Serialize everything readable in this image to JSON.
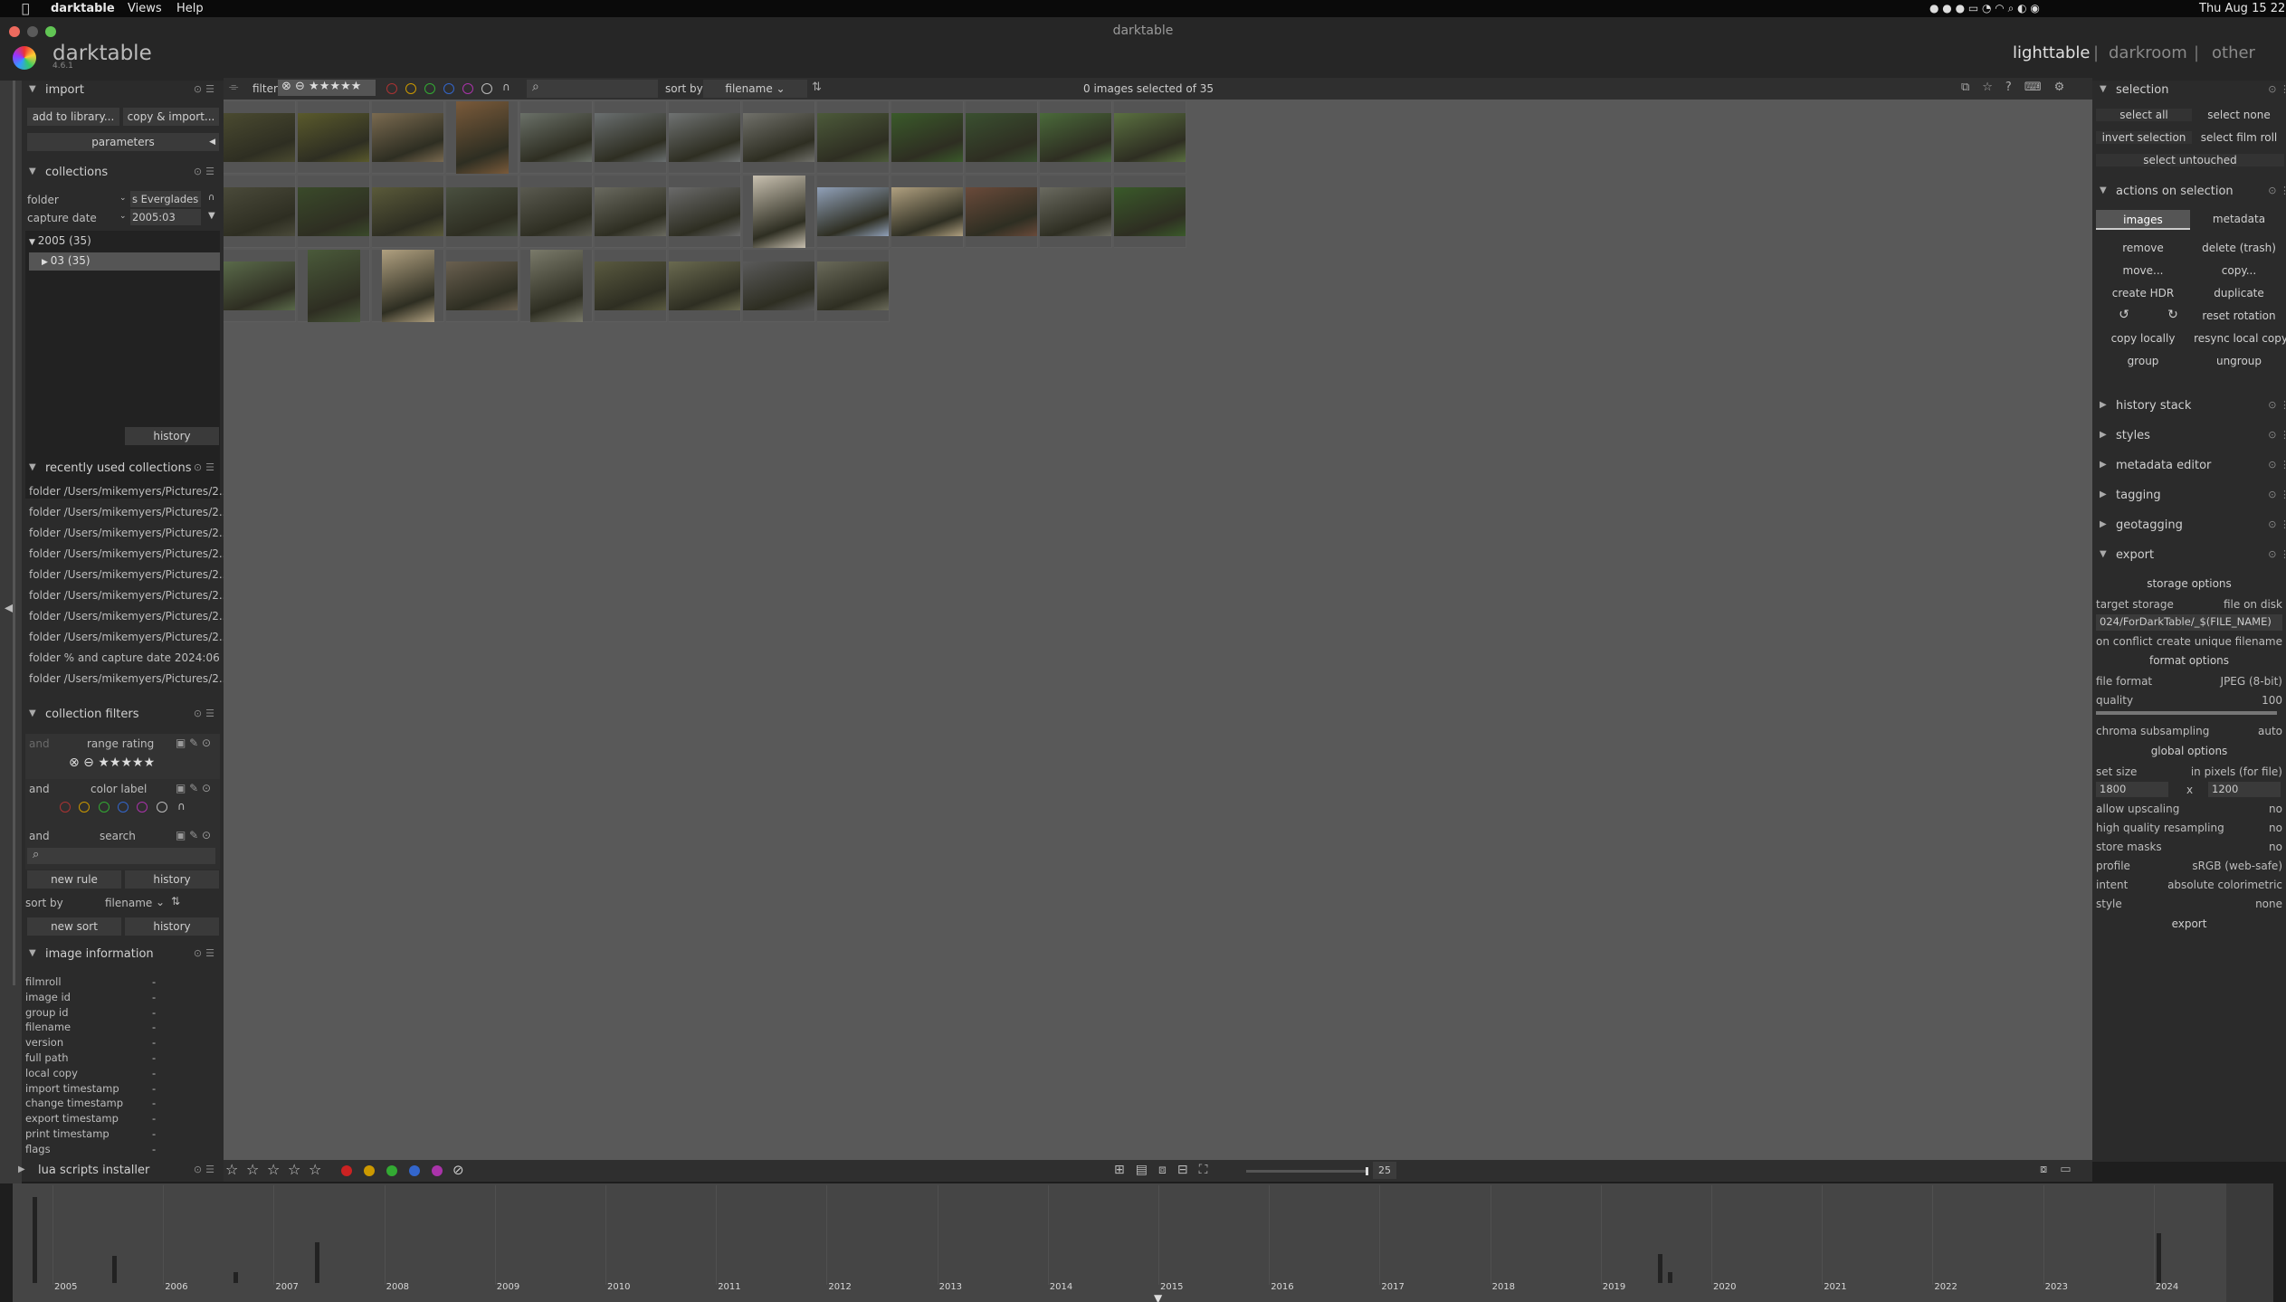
{
  "menubar": {
    "app": "darktable",
    "views": "Views",
    "help": "Help",
    "clock": "Thu Aug 15 22"
  },
  "window": {
    "title": "darktable"
  },
  "logo": {
    "name": "darktable",
    "version": "4.6.1"
  },
  "views": {
    "lighttable": "lighttable",
    "sep1": "|",
    "darkroom": "darkroom",
    "sep2": "|",
    "other": "other"
  },
  "topbar": {
    "filter": "filter",
    "search_placeholder": "",
    "sort_by": "sort by",
    "sort_field": "filename",
    "status": "0 images selected of 35"
  },
  "import": {
    "title": "import",
    "add": "add to library...",
    "copy": "copy & import...",
    "parameters": "parameters"
  },
  "collections": {
    "title": "collections",
    "rule1_label": "folder",
    "rule1_value": "s Everglades",
    "rule2_label": "capture date",
    "rule2_value": "2005:03",
    "tree": [
      {
        "label": "2005 (35)"
      },
      {
        "label": "03 (35)"
      }
    ],
    "history": "history"
  },
  "recent": {
    "title": "recently used collections",
    "items": [
      "folder /Users/mikemyers/Pictures/2...",
      "folder /Users/mikemyers/Pictures/2...",
      "folder /Users/mikemyers/Pictures/2...",
      "folder /Users/mikemyers/Pictures/2...",
      "folder /Users/mikemyers/Pictures/2...",
      "folder /Users/mikemyers/Pictures/2...",
      "folder /Users/mikemyers/Pictures/2...",
      "folder /Users/mikemyers/Pictures/2...",
      "folder % and capture date 2024:06",
      "folder /Users/mikemyers/Pictures/2..."
    ]
  },
  "filters": {
    "title": "collection filters",
    "rows": [
      {
        "op": "and",
        "name": "range rating"
      },
      {
        "op": "and",
        "name": "color label"
      },
      {
        "op": "and",
        "name": "search"
      }
    ],
    "new_rule": "new rule",
    "history": "history",
    "sort_by": "sort by",
    "sort_value": "filename",
    "new_sort": "new sort",
    "history2": "history"
  },
  "imageinfo": {
    "title": "image information",
    "rows": [
      {
        "k": "filmroll",
        "v": "-"
      },
      {
        "k": "image id",
        "v": "-"
      },
      {
        "k": "group id",
        "v": "-"
      },
      {
        "k": "filename",
        "v": "-"
      },
      {
        "k": "version",
        "v": "-"
      },
      {
        "k": "full path",
        "v": "-"
      },
      {
        "k": "local copy",
        "v": "-"
      },
      {
        "k": "import timestamp",
        "v": "-"
      },
      {
        "k": "change timestamp",
        "v": "-"
      },
      {
        "k": "export timestamp",
        "v": "-"
      },
      {
        "k": "print timestamp",
        "v": "-"
      },
      {
        "k": "flags",
        "v": "-"
      }
    ]
  },
  "lua": {
    "title": "lua scripts installer"
  },
  "selection": {
    "title": "selection",
    "select_all": "select all",
    "select_none": "select none",
    "invert": "invert selection",
    "select_film": "select film roll",
    "untouched": "select untouched"
  },
  "actions": {
    "title": "actions on selection",
    "tab_images": "images",
    "tab_metadata": "metadata",
    "remove": "remove",
    "delete": "delete (trash)",
    "move": "move...",
    "copy": "copy...",
    "hdr": "create HDR",
    "duplicate": "duplicate",
    "reset": "reset rotation",
    "copy_local": "copy locally",
    "resync": "resync local copy",
    "group": "group",
    "ungroup": "ungroup"
  },
  "modules": [
    {
      "label": "history stack"
    },
    {
      "label": "styles"
    },
    {
      "label": "metadata editor"
    },
    {
      "label": "tagging"
    },
    {
      "label": "geotagging"
    },
    {
      "label": "export"
    }
  ],
  "export": {
    "storage_options": "storage options",
    "target_storage_label": "target storage",
    "target_storage": "file on disk",
    "path": "024/ForDarkTable/_$(FILE_NAME)",
    "on_conflict_label": "on conflict",
    "on_conflict": "create unique filename",
    "format_options": "format options",
    "file_format_label": "file format",
    "file_format": "JPEG (8-bit)",
    "quality_label": "quality",
    "quality": "100",
    "chroma_label": "chroma subsampling",
    "chroma": "auto",
    "global_options": "global options",
    "set_size_label": "set size",
    "set_size": "in pixels (for file)",
    "width": "1800",
    "x": "x",
    "height": "1200",
    "upscaling_label": "allow upscaling",
    "upscaling": "no",
    "hq_label": "high quality resampling",
    "hq": "no",
    "masks_label": "store masks",
    "masks": "no",
    "profile_label": "profile",
    "profile": "sRGB (web-safe)",
    "intent_label": "intent",
    "intent": "absolute colorimetric",
    "style_label": "style",
    "style": "none",
    "export_btn": "export"
  },
  "bottom": {
    "zoom": "25"
  },
  "timeline": {
    "years": [
      "2005",
      "2006",
      "2007",
      "2008",
      "2009",
      "2010",
      "2011",
      "2012",
      "2013",
      "2014",
      "2015",
      "2016",
      "2017",
      "2018",
      "2019",
      "2020",
      "2021",
      "2022",
      "2023",
      "2024"
    ]
  },
  "thumbs": [
    {
      "c": "#4a4a30"
    },
    {
      "c": "#5a5a2c"
    },
    {
      "c": "#7a6a50"
    },
    {
      "c": "#7a5a3a"
    },
    {
      "c": "#6a7068"
    },
    {
      "c": "#6a6f70"
    },
    {
      "c": "#6f7272"
    },
    {
      "c": "#70706a"
    },
    {
      "c": "#4c5a3a"
    },
    {
      "c": "#3a5a2a"
    },
    {
      "c": "#3a5030"
    },
    {
      "c": "#4a6a3a"
    },
    {
      "c": "#5a7040"
    },
    {
      "c": "#4a4a3a"
    },
    {
      "c": "#3a4a2a"
    },
    {
      "c": "#5a5a3a"
    },
    {
      "c": "#4a5040"
    },
    {
      "c": "#5a5a50"
    },
    {
      "c": "#6a6a60"
    },
    {
      "c": "#6a6a6a"
    },
    {
      "c": "#c8c0b0"
    },
    {
      "c": "#90a0b8"
    },
    {
      "c": "#b0a080"
    },
    {
      "c": "#6a4a3a"
    },
    {
      "c": "#6a6a60"
    },
    {
      "c": "#3a5a2a"
    },
    {
      "c": "#5a6a4a"
    },
    {
      "c": "#4a5a3a"
    },
    {
      "c": "#b0a080"
    },
    {
      "c": "#6a6050"
    },
    {
      "c": "#7a7a6a"
    },
    {
      "c": "#5a5a40"
    },
    {
      "c": "#6a6a50"
    },
    {
      "c": "#5a5a5a"
    },
    {
      "c": "#6a6a5a"
    }
  ]
}
